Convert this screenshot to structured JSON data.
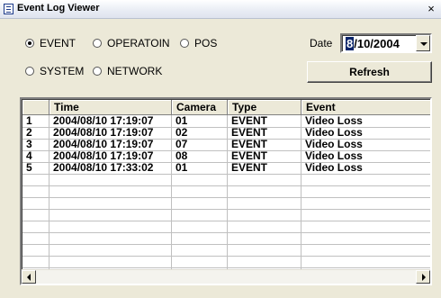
{
  "window": {
    "title": "Event Log Viewer",
    "close_symbol": "×",
    "app_icon": "list-document-icon"
  },
  "filters": {
    "event": "EVENT",
    "operation": "OPERATOIN",
    "pos": "POS",
    "system": "SYSTEM",
    "network": "NETWORK",
    "selected": "EVENT"
  },
  "date": {
    "label": "Date",
    "value_highlighted": "8",
    "value_rest": "/10/2004"
  },
  "refresh_label": "Refresh",
  "table": {
    "headers": [
      "",
      "Time",
      "Camera",
      "Type",
      "Event"
    ],
    "rows": [
      [
        "1",
        "2004/08/10 17:19:07",
        "01",
        "EVENT",
        "Video Loss"
      ],
      [
        "2",
        "2004/08/10 17:19:07",
        "02",
        "EVENT",
        "Video Loss"
      ],
      [
        "3",
        "2004/08/10 17:19:07",
        "07",
        "EVENT",
        "Video Loss"
      ],
      [
        "4",
        "2004/08/10 17:19:07",
        "08",
        "EVENT",
        "Video Loss"
      ],
      [
        "5",
        "2004/08/10 17:33:02",
        "01",
        "EVENT",
        "Video Loss"
      ]
    ]
  },
  "colors": {
    "window_bg": "#ece9d8",
    "selection": "#0a246a"
  }
}
